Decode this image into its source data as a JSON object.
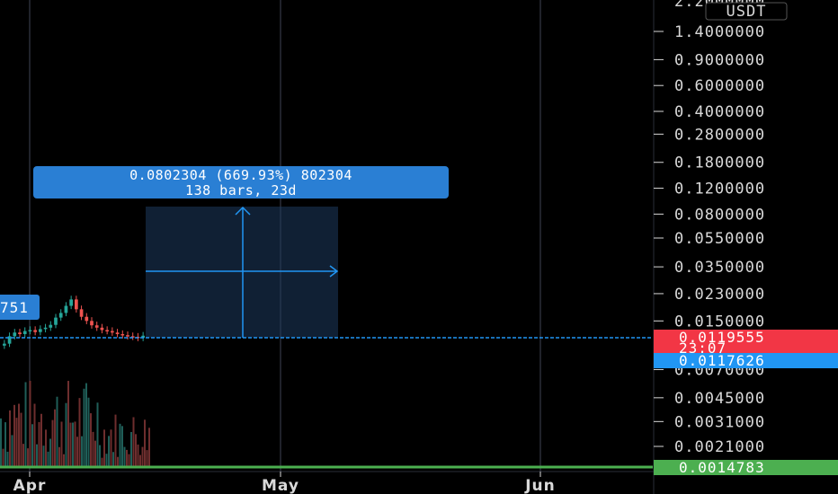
{
  "chart_data": {
    "type": "candlestick",
    "quote_currency": "USDT",
    "scale": "log",
    "price_ticks": [
      "1.4000000",
      "0.9000000",
      "0.6000000",
      "0.4000000",
      "0.2800000",
      "0.1800000",
      "0.1200000",
      "0.0800000",
      "0.0550000",
      "0.0350000",
      "0.0230000",
      "0.0150000",
      "0.0070000",
      "0.0045000",
      "0.0031000",
      "0.0021000"
    ],
    "top_partial_tick": "2.2000000",
    "time_ticks": [
      "Apr",
      "May",
      "Jun"
    ],
    "last_price": {
      "value": "0.0119555",
      "countdown": "23:07",
      "color": "#f23645"
    },
    "line_price": {
      "value": "0.0117626",
      "color": "#2196f3"
    },
    "low_price": {
      "value": "0.0014783",
      "color": "#4caf50"
    },
    "left_edge_label": "751",
    "measure": {
      "line1": "0.0802304 (669.93%) 802304",
      "line2": "138 bars, 23d",
      "color": "#2a7fd4"
    },
    "candles_approx": [
      0.0105,
      0.0118,
      0.0125,
      0.0122,
      0.0128,
      0.013,
      0.0126,
      0.0132,
      0.0135,
      0.0141,
      0.0158,
      0.017,
      0.019,
      0.021,
      0.018,
      0.016,
      0.015,
      0.014,
      0.0135,
      0.013,
      0.0128,
      0.0125,
      0.0122,
      0.012,
      0.0118,
      0.0117,
      0.0115,
      0.0119
    ]
  }
}
